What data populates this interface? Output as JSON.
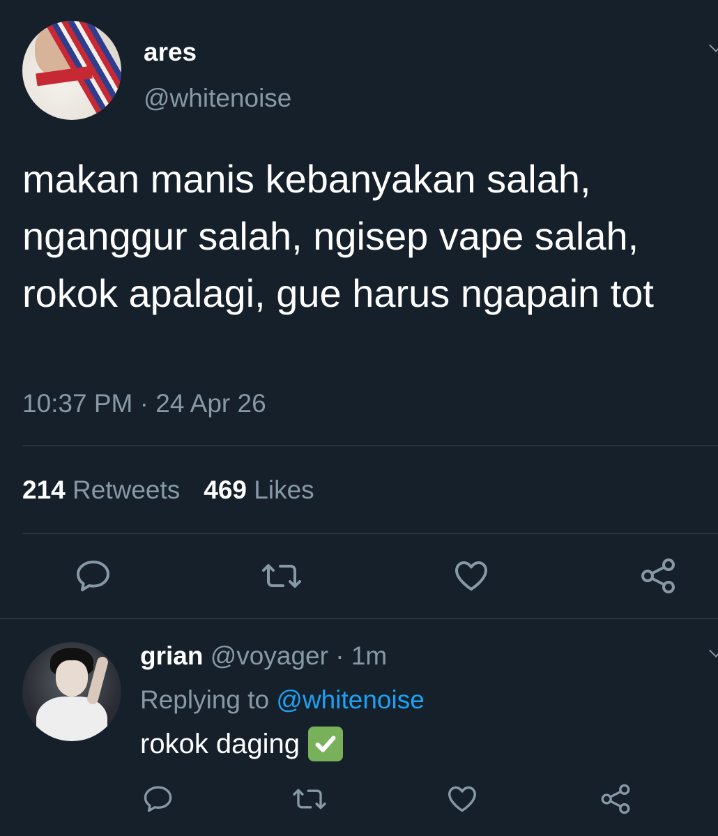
{
  "tweet": {
    "author_name": "ares",
    "author_handle": "@whitenoise",
    "text": "makan manis kebanyakan salah, nganggur salah, ngisep vape salah, rokok apalagi, gue harus ngapain tot",
    "timestamp": "10:37 PM · 24 Apr 26",
    "retweet_count": "214",
    "retweet_label": "Retweets",
    "like_count": "469",
    "like_label": "Likes"
  },
  "reply": {
    "author_name": "grian",
    "author_handle": "@voyager",
    "time_ago": "· 1m",
    "replying_prefix": "Replying to",
    "replying_handle": "@whitenoise",
    "text": "rokok daging"
  },
  "colors": {
    "background": "#15202b",
    "secondary_text": "#8899a6",
    "accent": "#1da1f2",
    "divider": "#38444d",
    "check_emoji": "#78b159"
  },
  "icons": {
    "reply": "reply-icon",
    "retweet": "retweet-icon",
    "like": "heart-icon",
    "share": "share-icon",
    "more": "chevron-down-icon",
    "check": "check-mark-emoji"
  }
}
